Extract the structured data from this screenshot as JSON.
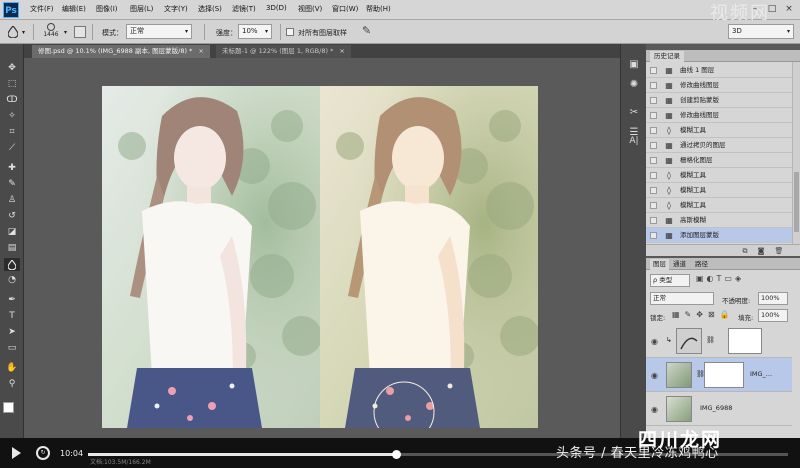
{
  "app": {
    "logo": "Ps",
    "watermark": "视频网"
  },
  "menu": [
    "文件(F)",
    "编辑(E)",
    "图像(I)",
    "图层(L)",
    "文字(Y)",
    "选择(S)",
    "滤镜(T)",
    "3D(D)",
    "视图(V)",
    "窗口(W)",
    "帮助(H)"
  ],
  "window_controls": [
    "–",
    "□",
    "×"
  ],
  "options": {
    "brush_size": "1446",
    "mode_label": "模式：",
    "mode_value": "正常",
    "strength_label": "强度：",
    "strength_value": "10%",
    "sample_all_label": "对所有图层取样",
    "workspace": "3D"
  },
  "tabs": [
    {
      "label": "修图.psd @ 10.1% (IMG_6988 副本, 图层蒙版/8) *",
      "close": "×"
    },
    {
      "label": "未标题-1 @ 122% (图层 1, RGB/8) *",
      "close": "×"
    }
  ],
  "history": {
    "title": "历史记录",
    "items": [
      {
        "label": "曲线 1 图层",
        "icon": "layer-icon"
      },
      {
        "label": "修改曲线图层",
        "icon": "layer-icon"
      },
      {
        "label": "创建剪贴蒙版",
        "icon": "layer-icon"
      },
      {
        "label": "修改曲线图层",
        "icon": "layer-icon"
      },
      {
        "label": "模糊工具",
        "icon": "drop-icon"
      },
      {
        "label": "通过拷贝的图层",
        "icon": "layer-icon"
      },
      {
        "label": "栅格化图层",
        "icon": "layer-icon"
      },
      {
        "label": "模糊工具",
        "icon": "drop-icon"
      },
      {
        "label": "模糊工具",
        "icon": "drop-icon"
      },
      {
        "label": "模糊工具",
        "icon": "drop-icon"
      },
      {
        "label": "高斯模糊",
        "icon": "layer-icon"
      },
      {
        "label": "添加图层蒙版",
        "icon": "layer-icon"
      }
    ],
    "selected_index": 11
  },
  "layers": {
    "tabs": [
      "图层",
      "通道",
      "路径"
    ],
    "filter_label": "ρ 类型",
    "blend_mode": "正常",
    "opacity_label": "不透明度:",
    "opacity": "100%",
    "lock_label": "锁定:",
    "fill_label": "填充:",
    "fill": "100%",
    "items": [
      {
        "name": "",
        "type": "adjustment",
        "selected": false
      },
      {
        "name": "IMG_...",
        "type": "masked",
        "selected": true
      },
      {
        "name": "IMG_6988",
        "type": "photo",
        "selected": false
      }
    ]
  },
  "player": {
    "time": "10:04",
    "progress": 0.44,
    "doc_info": "文档:103.5M/166.2M"
  },
  "credit": "头条号 / 春天里冷冻鸡鸭心",
  "brand_watermark": "四川龙网"
}
